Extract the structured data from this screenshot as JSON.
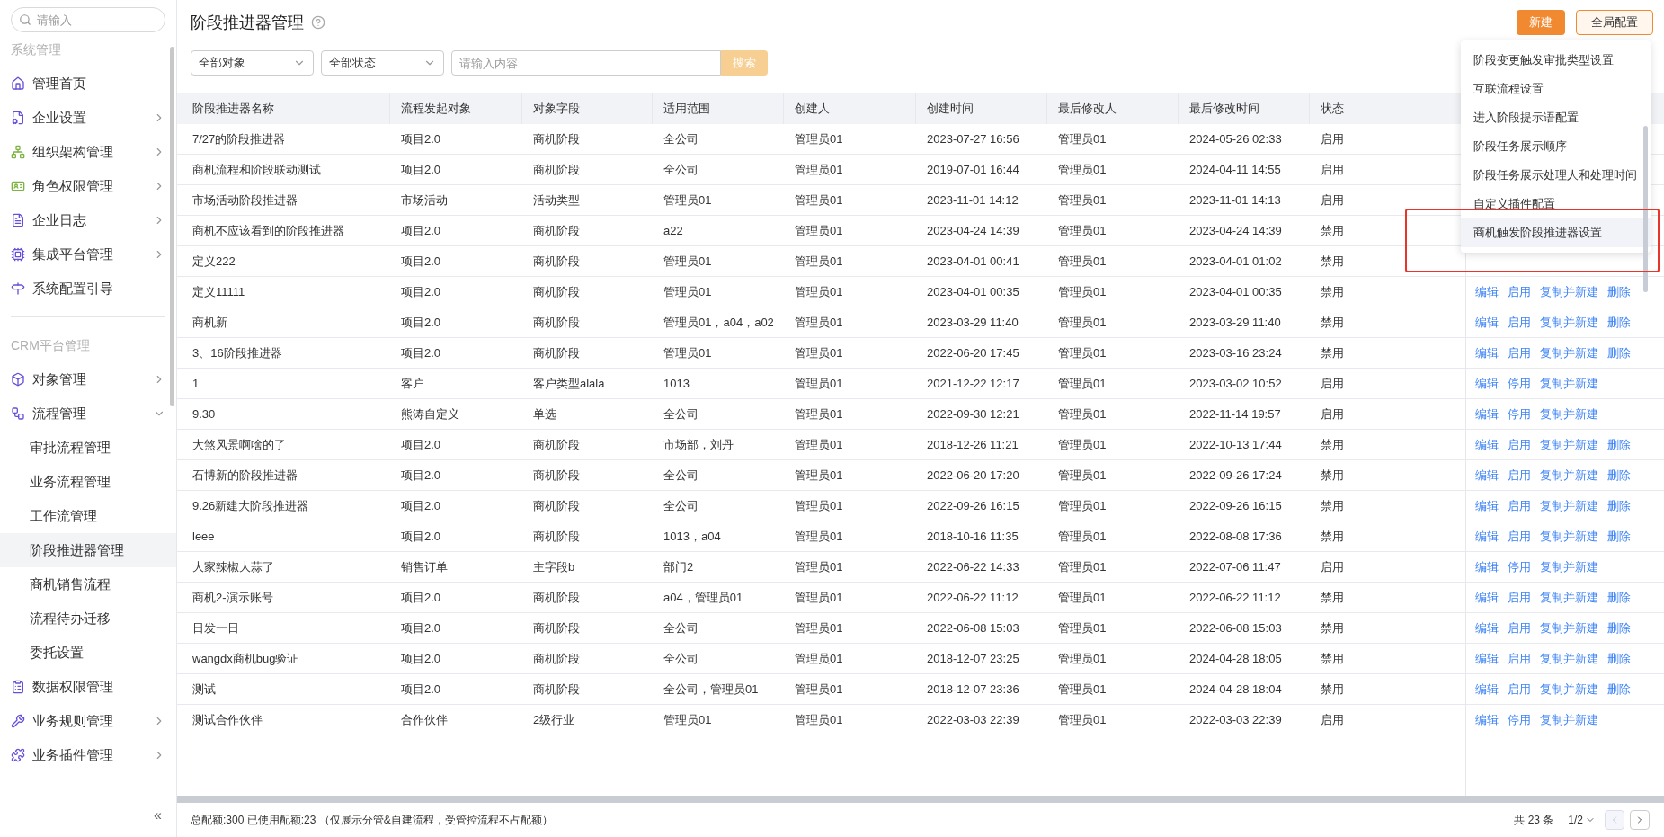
{
  "sidebar": {
    "search_placeholder": "请输入",
    "sections": [
      {
        "title": "系统管理",
        "items": [
          {
            "label": "管理首页",
            "kind": "link",
            "selected": false
          },
          {
            "label": "企业设置",
            "kind": "group",
            "expanded": false,
            "selected": false
          },
          {
            "label": "组织架构管理",
            "kind": "group",
            "expanded": false,
            "selected": false
          },
          {
            "label": "角色权限管理",
            "kind": "group",
            "expanded": false,
            "selected": false
          },
          {
            "label": "企业日志",
            "kind": "group",
            "expanded": false,
            "selected": false
          },
          {
            "label": "集成平台管理",
            "kind": "group",
            "expanded": false,
            "selected": false
          },
          {
            "label": "系统配置引导",
            "kind": "link",
            "selected": false
          }
        ]
      },
      {
        "title": "CRM平台管理",
        "items": [
          {
            "label": "对象管理",
            "kind": "group",
            "expanded": false,
            "selected": false
          },
          {
            "label": "流程管理",
            "kind": "group",
            "expanded": true,
            "selected": false,
            "children": [
              {
                "label": "审批流程管理",
                "selected": false
              },
              {
                "label": "业务流程管理",
                "selected": false
              },
              {
                "label": "工作流管理",
                "selected": false
              },
              {
                "label": "阶段推进器管理",
                "selected": true
              },
              {
                "label": "商机销售流程",
                "selected": false
              },
              {
                "label": "流程待办迁移",
                "selected": false
              },
              {
                "label": "委托设置",
                "selected": false
              }
            ]
          },
          {
            "label": "数据权限管理",
            "kind": "link",
            "selected": false
          },
          {
            "label": "业务规则管理",
            "kind": "group",
            "expanded": false,
            "selected": false
          },
          {
            "label": "业务插件管理",
            "kind": "group",
            "expanded": false,
            "selected": false
          }
        ]
      }
    ],
    "collapse": "«"
  },
  "page": {
    "title": "阶段推进器管理",
    "buttons": [
      {
        "label": "新建",
        "kind": "primary"
      },
      {
        "label": "全局配置",
        "kind": "outline"
      }
    ]
  },
  "filters": {
    "object": "全部对象",
    "status": "全部状态",
    "search_placeholder": "请输入内容",
    "search_button": "搜索"
  },
  "dropdown": {
    "items": [
      {
        "label": "阶段变更触发审批类型设置",
        "selected": false
      },
      {
        "label": "互联流程设置",
        "selected": false
      },
      {
        "label": "进入阶段提示语配置",
        "selected": false
      },
      {
        "label": "阶段任务展示顺序",
        "selected": false
      },
      {
        "label": "阶段任务展示处理人和处理时间",
        "selected": false
      },
      {
        "label": "自定义插件配置",
        "selected": false
      },
      {
        "label": "商机触发阶段推进器设置",
        "selected": true
      }
    ]
  },
  "table": {
    "columns": [
      "阶段推进器名称",
      "流程发起对象",
      "对象字段",
      "适用范围",
      "创建人",
      "创建时间",
      "最后修改人",
      "最后修改时间",
      "状态"
    ],
    "rows": [
      {
        "cells": [
          "7/27的阶段推进器",
          "项目2.0",
          "商机阶段",
          "全公司",
          "管理员01",
          "2023-07-27 16:56",
          "管理员01",
          "2024-05-26 02:33",
          "启用"
        ]
      },
      {
        "cells": [
          "商机流程和阶段联动测试",
          "项目2.0",
          "商机阶段",
          "全公司",
          "管理员01",
          "2019-07-01 16:44",
          "管理员01",
          "2024-04-11 14:55",
          "启用"
        ]
      },
      {
        "cells": [
          "市场活动阶段推进器",
          "市场活动",
          "活动类型",
          "管理员01",
          "管理员01",
          "2023-11-01 14:12",
          "管理员01",
          "2023-11-01 14:13",
          "启用"
        ]
      },
      {
        "cells": [
          "商机不应该看到的阶段推进器",
          "项目2.0",
          "商机阶段",
          "a22",
          "管理员01",
          "2023-04-24 14:39",
          "管理员01",
          "2023-04-24 14:39",
          "禁用"
        ]
      },
      {
        "cells": [
          "定义222",
          "项目2.0",
          "商机阶段",
          "管理员01",
          "管理员01",
          "2023-04-01 00:41",
          "管理员01",
          "2023-04-01 01:02",
          "禁用"
        ]
      },
      {
        "cells": [
          "定义11111",
          "项目2.0",
          "商机阶段",
          "管理员01",
          "管理员01",
          "2023-04-01 00:35",
          "管理员01",
          "2023-04-01 00:35",
          "禁用"
        ],
        "actions": [
          "编辑",
          "启用",
          "复制并新建",
          "删除"
        ]
      },
      {
        "cells": [
          "商机新",
          "项目2.0",
          "商机阶段",
          "管理员01，a04，a02",
          "管理员01",
          "2023-03-29 11:40",
          "管理员01",
          "2023-03-29 11:40",
          "禁用"
        ],
        "actions": [
          "编辑",
          "启用",
          "复制并新建",
          "删除"
        ]
      },
      {
        "cells": [
          "3、16阶段推进器",
          "项目2.0",
          "商机阶段",
          "管理员01",
          "管理员01",
          "2022-06-20 17:45",
          "管理员01",
          "2023-03-16 23:24",
          "禁用"
        ],
        "actions": [
          "编辑",
          "启用",
          "复制并新建",
          "删除"
        ]
      },
      {
        "cells": [
          "1",
          "客户",
          "客户类型alala",
          "1013",
          "管理员01",
          "2021-12-22 12:17",
          "管理员01",
          "2023-03-02 10:52",
          "启用"
        ],
        "actions": [
          "编辑",
          "停用",
          "复制并新建"
        ]
      },
      {
        "cells": [
          "9.30",
          "熊涛自定义",
          "单选",
          "全公司",
          "管理员01",
          "2022-09-30 12:21",
          "管理员01",
          "2022-11-14 19:57",
          "启用"
        ],
        "actions": [
          "编辑",
          "停用",
          "复制并新建"
        ]
      },
      {
        "cells": [
          "大煞风景啊啥的了",
          "项目2.0",
          "商机阶段",
          "市场部，刘丹",
          "管理员01",
          "2018-12-26 11:21",
          "管理员01",
          "2022-10-13 17:44",
          "禁用"
        ],
        "actions": [
          "编辑",
          "启用",
          "复制并新建",
          "删除"
        ]
      },
      {
        "cells": [
          "石博新的阶段推进器",
          "项目2.0",
          "商机阶段",
          "全公司",
          "管理员01",
          "2022-06-20 17:20",
          "管理员01",
          "2022-09-26 17:24",
          "禁用"
        ],
        "actions": [
          "编辑",
          "启用",
          "复制并新建",
          "删除"
        ]
      },
      {
        "cells": [
          "9.26新建大阶段推进器",
          "项目2.0",
          "商机阶段",
          "全公司",
          "管理员01",
          "2022-09-26 16:15",
          "管理员01",
          "2022-09-26 16:15",
          "禁用"
        ],
        "actions": [
          "编辑",
          "启用",
          "复制并新建",
          "删除"
        ]
      },
      {
        "cells": [
          "leee",
          "项目2.0",
          "商机阶段",
          "1013，a04",
          "管理员01",
          "2018-10-16 11:35",
          "管理员01",
          "2022-08-08 17:36",
          "禁用"
        ],
        "actions": [
          "编辑",
          "启用",
          "复制并新建",
          "删除"
        ]
      },
      {
        "cells": [
          "大家辣椒大蒜了",
          "销售订单",
          "主字段b",
          "部门2",
          "管理员01",
          "2022-06-22 14:33",
          "管理员01",
          "2022-07-06 11:47",
          "启用"
        ],
        "actions": [
          "编辑",
          "停用",
          "复制并新建"
        ]
      },
      {
        "cells": [
          "商机2-演示账号",
          "项目2.0",
          "商机阶段",
          "a04，管理员01",
          "管理员01",
          "2022-06-22 11:12",
          "管理员01",
          "2022-06-22 11:12",
          "禁用"
        ],
        "actions": [
          "编辑",
          "启用",
          "复制并新建",
          "删除"
        ]
      },
      {
        "cells": [
          "日发一日",
          "项目2.0",
          "商机阶段",
          "全公司",
          "管理员01",
          "2022-06-08 15:03",
          "管理员01",
          "2022-06-08 15:03",
          "禁用"
        ],
        "actions": [
          "编辑",
          "启用",
          "复制并新建",
          "删除"
        ]
      },
      {
        "cells": [
          "wangdx商机bug验证",
          "项目2.0",
          "商机阶段",
          "全公司",
          "管理员01",
          "2018-12-07 23:25",
          "管理员01",
          "2024-04-28 18:05",
          "禁用"
        ],
        "actions": [
          "编辑",
          "启用",
          "复制并新建",
          "删除"
        ]
      },
      {
        "cells": [
          "测试",
          "项目2.0",
          "商机阶段",
          "全公司，管理员01",
          "管理员01",
          "2018-12-07 23:36",
          "管理员01",
          "2024-04-28 18:04",
          "禁用"
        ],
        "actions": [
          "编辑",
          "启用",
          "复制并新建",
          "删除"
        ]
      },
      {
        "cells": [
          "测试合作伙伴",
          "合作伙伴",
          "2级行业",
          "管理员01",
          "管理员01",
          "2022-03-03 22:39",
          "管理员01",
          "2022-03-03 22:39",
          "启用"
        ],
        "actions": [
          "编辑",
          "停用",
          "复制并新建"
        ]
      }
    ]
  },
  "footer": {
    "quota": "总配额:300 已使用配额:23 （仅展示分管&自建流程，受管控流程不占配额）",
    "total": "共 23 条",
    "page": "1/2"
  }
}
